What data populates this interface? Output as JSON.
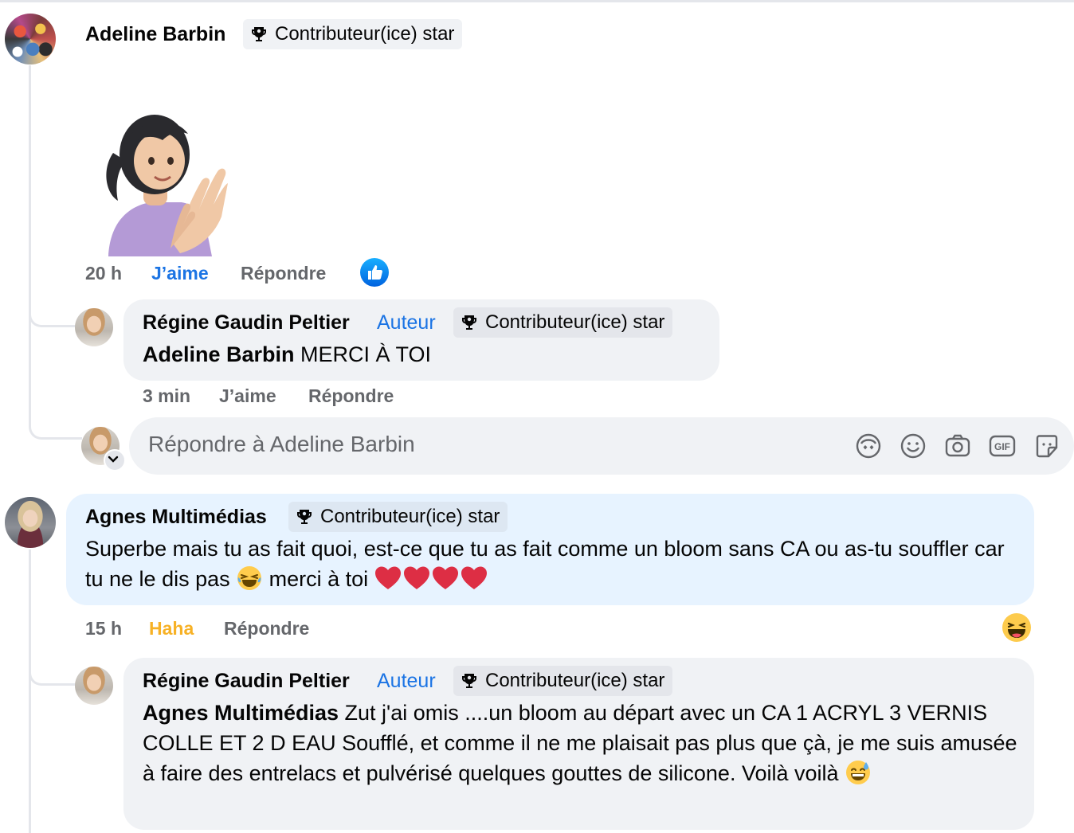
{
  "thread": {
    "comment1": {
      "author": "Adeline Barbin",
      "badge": "Contributeur(ice) star",
      "time": "20 h",
      "like_label": "J’aime",
      "reply_label": "Répondre",
      "reaction": "like-icon"
    },
    "reply1": {
      "author": "Régine Gaudin Peltier",
      "author_tag": "Auteur",
      "badge": "Contributeur(ice) star",
      "mention": "Adeline Barbin",
      "text": " MERCI À TOI",
      "time": "3 min",
      "like_label": "J’aime",
      "reply_label": "Répondre"
    },
    "reply_input": {
      "placeholder": "Répondre à Adeline Barbin"
    },
    "comment2": {
      "author": "Agnes Multimédias",
      "badge": "Contributeur(ice) star",
      "text_part1": "Superbe mais tu as fait quoi, est-ce que tu as fait comme un bloom sans CA ou as-tu souffler car tu ne le dis pas ",
      "text_part2": " merci à toi ",
      "time": "15 h",
      "reaction_label": "Haha",
      "reply_label": "Répondre",
      "reaction": "haha-icon"
    },
    "reply2": {
      "author": "Régine Gaudin Peltier",
      "author_tag": "Auteur",
      "badge": "Contributeur(ice) star",
      "mention": "Agnes Multimédias",
      "text": " Zut j'ai omis ....un bloom au départ avec un CA 1 ACRYL 3 VERNIS COLLE ET 2 D EAU Soufflé, et comme il ne me plaisait pas plus que çà, je me suis amusée à faire des entrelacs et pulvérisé quelques gouttes de silicone. Voilà voilà "
    }
  },
  "colors": {
    "link_blue": "#1b74e4",
    "haha_yellow": "#f7b125",
    "bubble_gray": "#f0f2f5",
    "bubble_blue": "#e7f3ff",
    "meta_gray": "#65676b"
  }
}
